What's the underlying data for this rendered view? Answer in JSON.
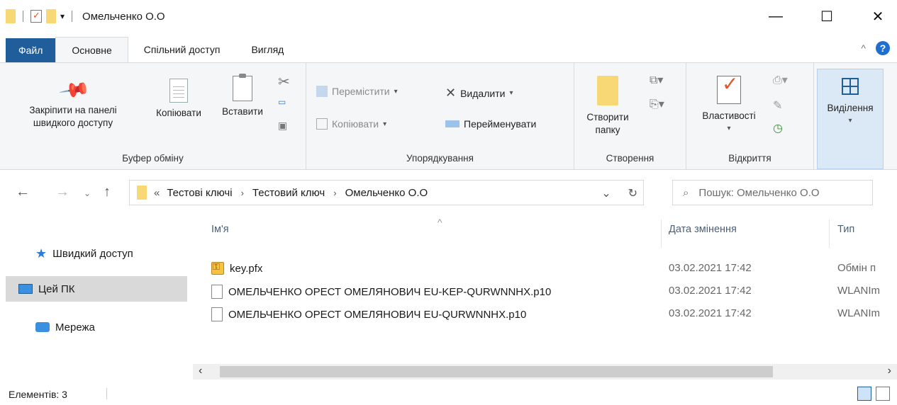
{
  "window": {
    "title": "Омельченко О.О",
    "min_label": "—",
    "max_label": "☐",
    "close_label": "✕"
  },
  "tabs": [
    {
      "label": "Файл"
    },
    {
      "label": "Основне"
    },
    {
      "label": "Спільний доступ"
    },
    {
      "label": "Вигляд"
    }
  ],
  "ribbon": {
    "clipboard": {
      "pin_label_1": "Закріпити на панелі",
      "pin_label_2": "швидкого доступу",
      "copy_label": "Копіювати",
      "paste_label": "Вставити",
      "group_label": "Буфер обміну"
    },
    "organize": {
      "move_label": "Перемістити",
      "copy_to_label": "Копіювати",
      "delete_label": "Видалити",
      "rename_label": "Перейменувати",
      "group_label": "Упорядкування"
    },
    "new": {
      "new_folder_1": "Створити",
      "new_folder_2": "папку",
      "group_label": "Створення"
    },
    "open": {
      "properties_label": "Властивості",
      "group_label": "Відкриття"
    },
    "select": {
      "select_label": "Виділення"
    }
  },
  "address": {
    "overflow": "«",
    "crumbs": [
      "Тестові ключі",
      "Тестовий ключ",
      "Омельченко О.О"
    ],
    "search_placeholder": "Пошук: Омельченко О.О"
  },
  "nav_pane": [
    {
      "label": "Швидкий доступ"
    },
    {
      "label": "Цей ПК"
    },
    {
      "label": "Мережа"
    }
  ],
  "columns": {
    "name": "Ім'я",
    "date": "Дата змінення",
    "type": "Тип"
  },
  "files": [
    {
      "name": "key.pfx",
      "date": "03.02.2021 17:42",
      "type": "Обмін п",
      "icon": "key-file-icon"
    },
    {
      "name": "ОМЕЛЬЧЕНКО ОРЕСТ ОМЕЛЯНОВИЧ EU-KEP-QURWNNHX.p10",
      "date": "03.02.2021 17:42",
      "type": "WLANIm",
      "icon": "blank-file-icon"
    },
    {
      "name": "ОМЕЛЬЧЕНКО ОРЕСТ ОМЕЛЯНОВИЧ EU-QURWNNHX.p10",
      "date": "03.02.2021 17:42",
      "type": "WLANIm",
      "icon": "blank-file-icon"
    }
  ],
  "status": {
    "items_text": "Елементів: 3"
  },
  "colors": {
    "file_tab": "#1f5e9b",
    "folder": "#f8d775",
    "selection": "#dbe9f7"
  }
}
